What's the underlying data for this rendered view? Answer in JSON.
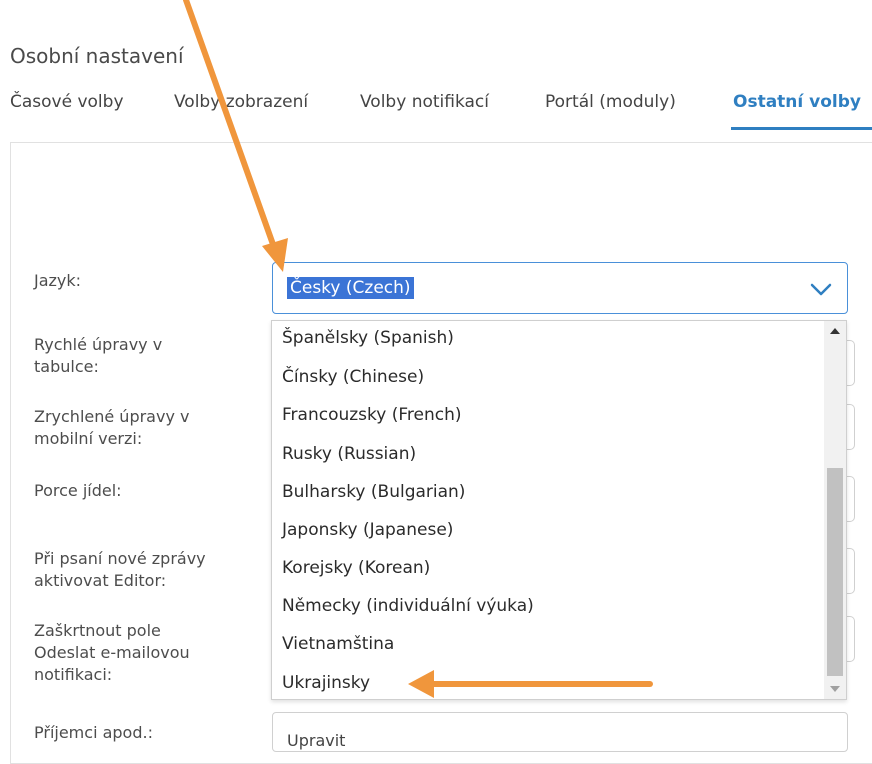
{
  "page": {
    "title": "Osobní nastavení"
  },
  "tabs": [
    {
      "label": "Časové volby"
    },
    {
      "label": "Volby zobrazení"
    },
    {
      "label": "Volby notifikací"
    },
    {
      "label": "Portál (moduly)"
    },
    {
      "label": "Ostatní volby",
      "active": true
    }
  ],
  "form": {
    "labels": {
      "language": "Jazyk:",
      "quick_edit_1": "Rychlé úpravy v",
      "quick_edit_2": "tabulce:",
      "mobile_edit_1": "Zrychlené úpravy v",
      "mobile_edit_2": "mobilní verzi:",
      "meal_portion": "Porce jídel:",
      "editor_1": "Při psaní nové zprávy",
      "editor_2": "aktivovat Editor:",
      "email_notif_1": "Zaškrtnout pole",
      "email_notif_2": "Odeslat e-mailovou",
      "email_notif_3": "notifikaci:",
      "recipients": "Příjemci apod.:"
    },
    "language_select": {
      "value": "Česky (Czech)",
      "options": [
        "Španělsky (Spanish)",
        "Čínsky (Chinese)",
        "Francouzsky (French)",
        "Rusky (Russian)",
        "Bulharsky (Bulgarian)",
        "Japonsky (Japanese)",
        "Korejsky (Korean)",
        "Německy (individuální výuka)",
        "Vietnamština",
        "Ukrajinsky"
      ]
    },
    "bottom_field_value": "Upravit"
  },
  "colors": {
    "accent": "#2f7fc1",
    "selection": "#3b74d6",
    "annotation_arrow": "#f0963c"
  },
  "icons": {
    "select_toggle": "chevron-down-icon",
    "scroll_up": "triangle-up-icon",
    "scroll_down": "triangle-down-icon"
  }
}
